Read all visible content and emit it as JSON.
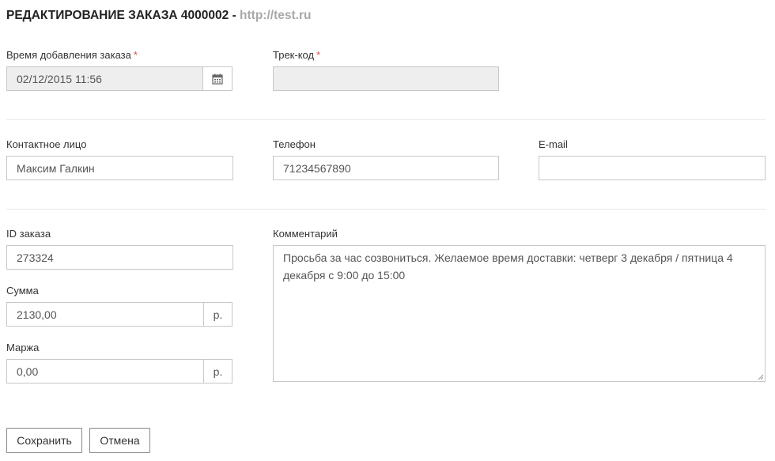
{
  "header": {
    "title": "РЕДАКТИРОВАНИЕ ЗАКАЗА 4000002",
    "separator": " - ",
    "site": "http://test.ru"
  },
  "form": {
    "order_time": {
      "label": "Время добавления заказа",
      "required_mark": "*",
      "value": "02/12/2015 11:56",
      "icon": "calendar-icon"
    },
    "track_code": {
      "label": "Трек-код",
      "required_mark": "*",
      "value": ""
    },
    "contact": {
      "label": "Контактное лицо",
      "value": "Максим Галкин"
    },
    "phone": {
      "label": "Телефон",
      "value": "71234567890"
    },
    "email": {
      "label": "E-mail",
      "value": ""
    },
    "order_id": {
      "label": "ID заказа",
      "value": "273324"
    },
    "sum": {
      "label": "Сумма",
      "value": "2130,00",
      "unit": "р."
    },
    "margin": {
      "label": "Маржа",
      "value": "0,00",
      "unit": "р."
    },
    "comment": {
      "label": "Комментарий",
      "value": "Просьба за час созвониться. Желаемое время доставки: четверг 3 декабря / пятница 4 декабря с 9:00 до 15:00"
    }
  },
  "buttons": {
    "save": "Сохранить",
    "cancel": "Отмена"
  },
  "colors": {
    "required": "#d9534f",
    "site_link": "#a8a8a8",
    "disabled_bg": "#eeeeee",
    "border": "#c8c8c8"
  }
}
